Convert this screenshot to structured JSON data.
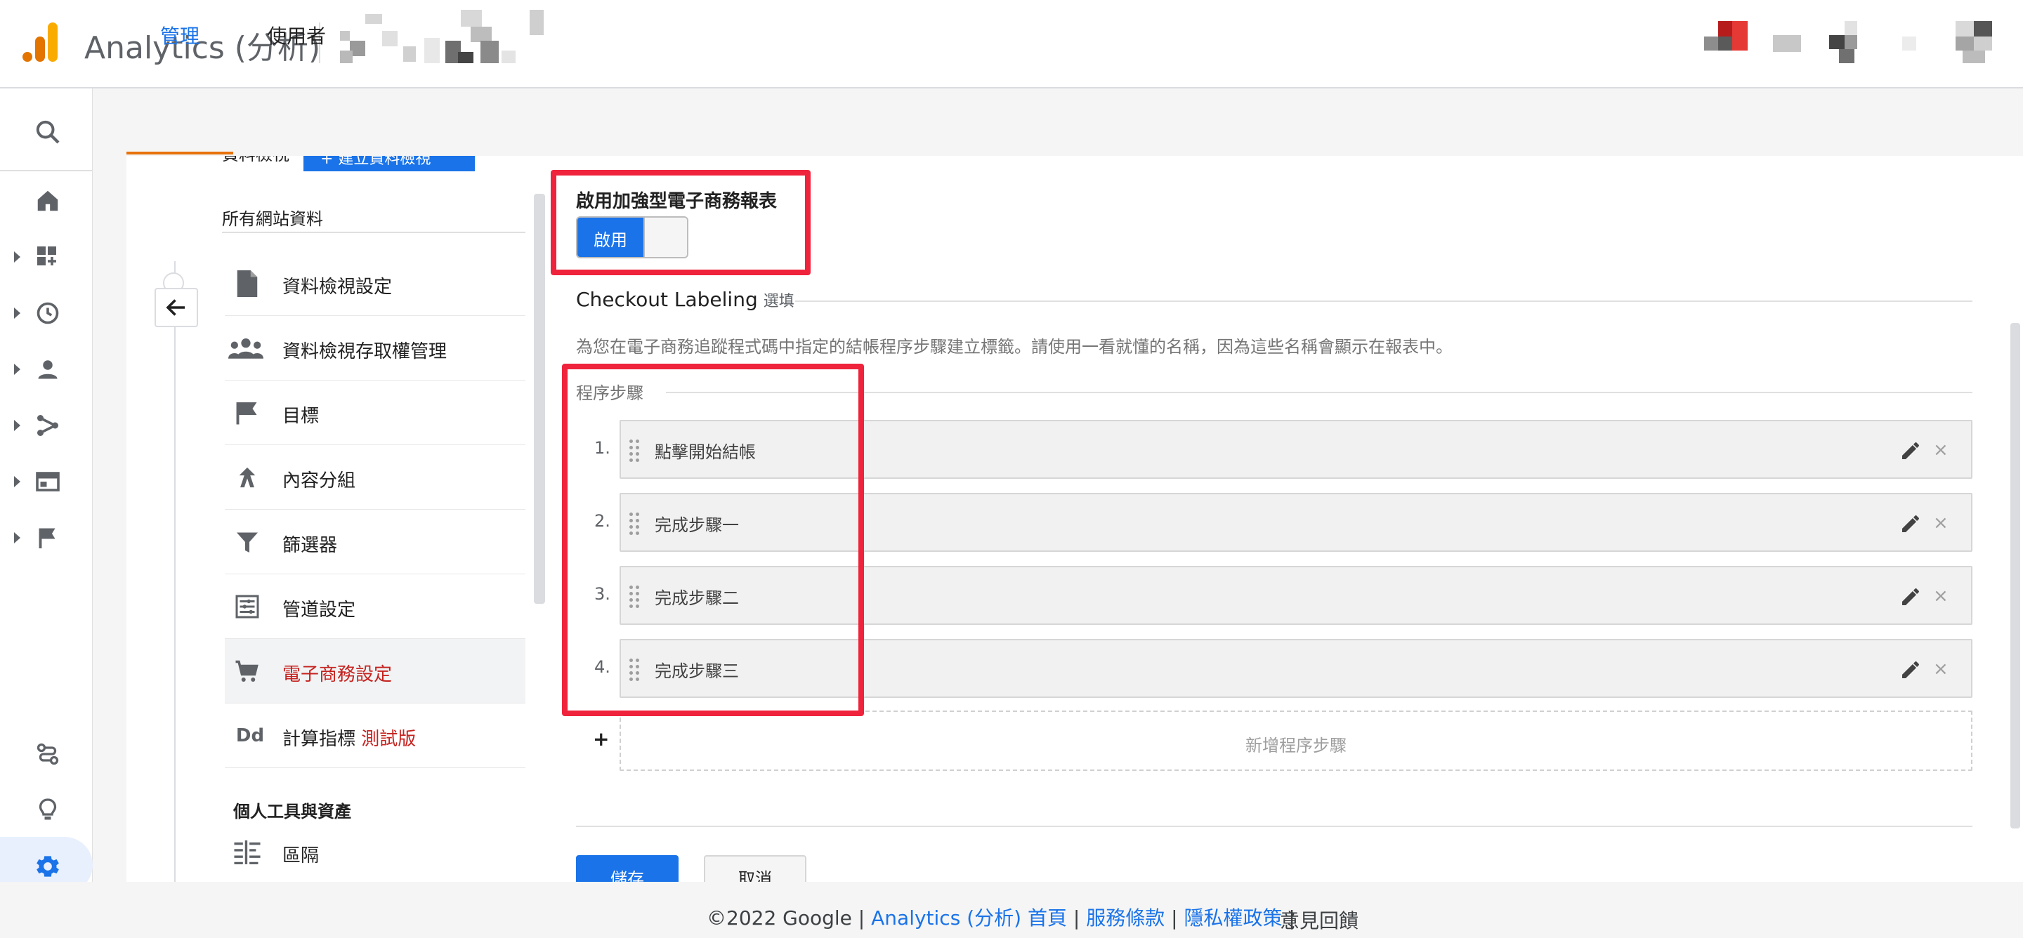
{
  "header": {
    "app_title": "Analytics (分析)"
  },
  "tabs": {
    "admin": "管理",
    "users": "使用者"
  },
  "nav": {
    "partial_top": "資料檢視",
    "partial_button": "+ 建立資料檢視",
    "section_label": "所有網站資料",
    "items": [
      {
        "label": "資料檢視設定",
        "icon": "document-icon"
      },
      {
        "label": "資料檢視存取權管理",
        "icon": "people-icon"
      },
      {
        "label": "目標",
        "icon": "flag-icon"
      },
      {
        "label": "內容分組",
        "icon": "content-grouping-icon"
      },
      {
        "label": "篩選器",
        "icon": "filter-icon"
      },
      {
        "label": "管道設定",
        "icon": "channel-settings-icon"
      },
      {
        "label": "電子商務設定",
        "icon": "cart-icon"
      },
      {
        "label": "計算指標",
        "icon": "dd-icon",
        "badge": "測試版"
      }
    ],
    "personal_heading": "個人工具與資產",
    "segments": "區隔"
  },
  "main": {
    "enhanced_label": "啟用加強型電子商務報表",
    "toggle_on": "啟用",
    "checkout_title": "Checkout Labeling",
    "checkout_optional": "選填",
    "checkout_desc": "為您在電子商務追蹤程式碼中指定的結帳程序步驟建立標籤。請使用一看就懂的名稱，因為這些名稱會顯示在報表中。",
    "steps_heading": "程序步驟",
    "steps": [
      {
        "num": "1.",
        "label": "點擊開始結帳"
      },
      {
        "num": "2.",
        "label": "完成步驟一"
      },
      {
        "num": "3.",
        "label": "完成步驟二"
      },
      {
        "num": "4.",
        "label": "完成步驟三"
      }
    ],
    "add_step": "新增程序步驟",
    "save": "儲存",
    "cancel": "取消"
  },
  "footer": {
    "copyright": "©2022 Google",
    "home": "Analytics (分析) 首頁",
    "terms": "服務條款",
    "privacy": "隱私權政策",
    "feedback": "意見回饋"
  },
  "colors": {
    "accent": "#1a73e8",
    "highlight": "#ef233c",
    "active_nav": "#c5221f",
    "tab_underline": "#e8710a"
  }
}
